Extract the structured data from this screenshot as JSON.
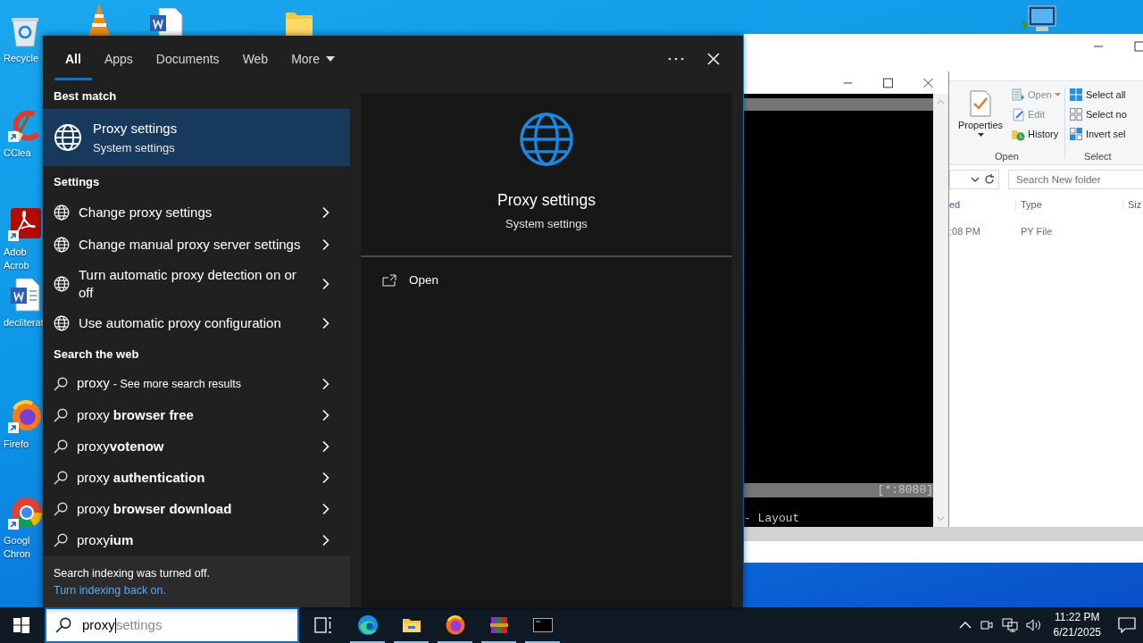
{
  "desktop": {
    "icons": [
      {
        "kind": "recycle_bin",
        "lines": [
          "Recycle"
        ]
      },
      {
        "kind": "ccleaner",
        "lines": [
          "CClea"
        ]
      },
      {
        "kind": "acrobat",
        "lines": [
          "Adob",
          "Acrob"
        ]
      },
      {
        "kind": "word_doc",
        "lines": [
          "decliterat"
        ]
      },
      {
        "kind": "firefox",
        "lines": [
          "Firefo"
        ]
      },
      {
        "kind": "chrome",
        "lines": [
          "Googl",
          "Chron"
        ]
      }
    ]
  },
  "explorer": {
    "ribbon": {
      "properties": "Properties",
      "open_actions": [
        {
          "kind": "open",
          "label": "Open",
          "disabled": true
        },
        {
          "kind": "edit",
          "label": "Edit",
          "disabled": true
        },
        {
          "kind": "history",
          "label": "History",
          "disabled": false
        }
      ],
      "open_group": "Open",
      "select_actions": [
        {
          "kind": "select_all",
          "label": "Select all",
          "disabled": false
        },
        {
          "kind": "select_none",
          "label": "Select no",
          "disabled": false
        },
        {
          "kind": "invert",
          "label": "Invert sel",
          "disabled": false
        }
      ],
      "select_group": "Select"
    },
    "search_placeholder": "Search New folder",
    "columns": [
      "ed",
      "Type",
      "Siz"
    ],
    "rows": [
      {
        "cells": [
          ":08 PM",
          "PY File"
        ]
      }
    ]
  },
  "console": {
    "status": "[*:8080]",
    "footer": "- Layout"
  },
  "search": {
    "tabs": [
      {
        "label": "All",
        "selected": true,
        "kind": "tab"
      },
      {
        "label": "Apps",
        "selected": false,
        "kind": "tab"
      },
      {
        "label": "Documents",
        "selected": false,
        "kind": "tab"
      },
      {
        "label": "Web",
        "selected": false,
        "kind": "tab"
      },
      {
        "label": "More",
        "selected": false,
        "kind": "dropdown"
      }
    ],
    "best_match_heading": "Best match",
    "best_match": {
      "title": "Proxy settings",
      "subtitle": "System settings",
      "selected": true
    },
    "settings_heading": "Settings",
    "settings_results": [
      {
        "label": "Change proxy settings",
        "selected": false
      },
      {
        "label": "Change manual proxy server settings",
        "selected": false
      },
      {
        "label": "Turn automatic proxy detection on or off",
        "selected": false
      },
      {
        "label": "Use automatic proxy configuration",
        "selected": false
      }
    ],
    "web_heading": "Search the web",
    "web_results": [
      {
        "label": "proxy",
        "note": "- See more search results",
        "selected": false
      },
      {
        "label": "proxy **browser free**",
        "selected": false
      },
      {
        "label": "proxy**votenow**",
        "selected": false
      },
      {
        "label": "proxy **authentication**",
        "selected": false
      },
      {
        "label": "proxy **browser download**",
        "selected": false
      },
      {
        "label": "proxy**ium**",
        "selected": false
      }
    ],
    "notice": {
      "text": "Search indexing was turned off.",
      "link": "Turn indexing back on."
    },
    "preview": {
      "title": "Proxy settings",
      "subtitle": "System settings",
      "actions": [
        {
          "label": "Open"
        }
      ]
    }
  },
  "taskbar": {
    "search": {
      "value": "proxy",
      "suggestion": "settings"
    },
    "apps": [
      {
        "kind": "task_view",
        "running": false
      },
      {
        "kind": "edge",
        "running": true
      },
      {
        "kind": "file_explorer",
        "running": true
      },
      {
        "kind": "firefox",
        "running": true
      },
      {
        "kind": "winrar",
        "running": true
      },
      {
        "kind": "terminal",
        "running": true
      }
    ],
    "clock": {
      "time": "11:22 PM",
      "date": "6/21/2025"
    }
  }
}
